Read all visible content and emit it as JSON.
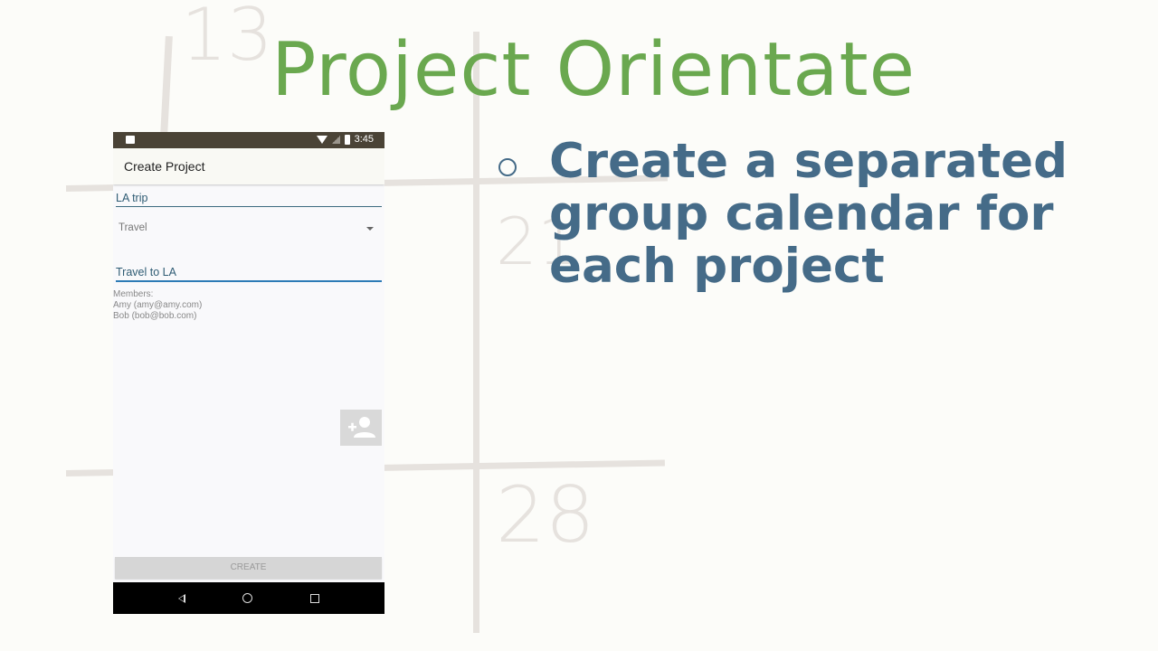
{
  "slide": {
    "title": "Project Orientate",
    "bullet": "Create a separated group calendar for each project",
    "calendar_numbers": [
      "13",
      "21",
      "28"
    ]
  },
  "phone": {
    "status_time": "3:45",
    "app_title": "Create Project",
    "project_name_value": "LA trip",
    "category_selected": "Travel",
    "description_value": "Travel to LA",
    "members_label": "Members:",
    "members": [
      "Amy (amy@amy.com)",
      "Bob (bob@bob.com)"
    ],
    "add_member_icon": "add-person-icon",
    "create_label": "CREATE"
  },
  "colors": {
    "title_green": "#6aa84f",
    "bullet_blue": "#456b88",
    "field_underline": "#2d7bb6"
  }
}
